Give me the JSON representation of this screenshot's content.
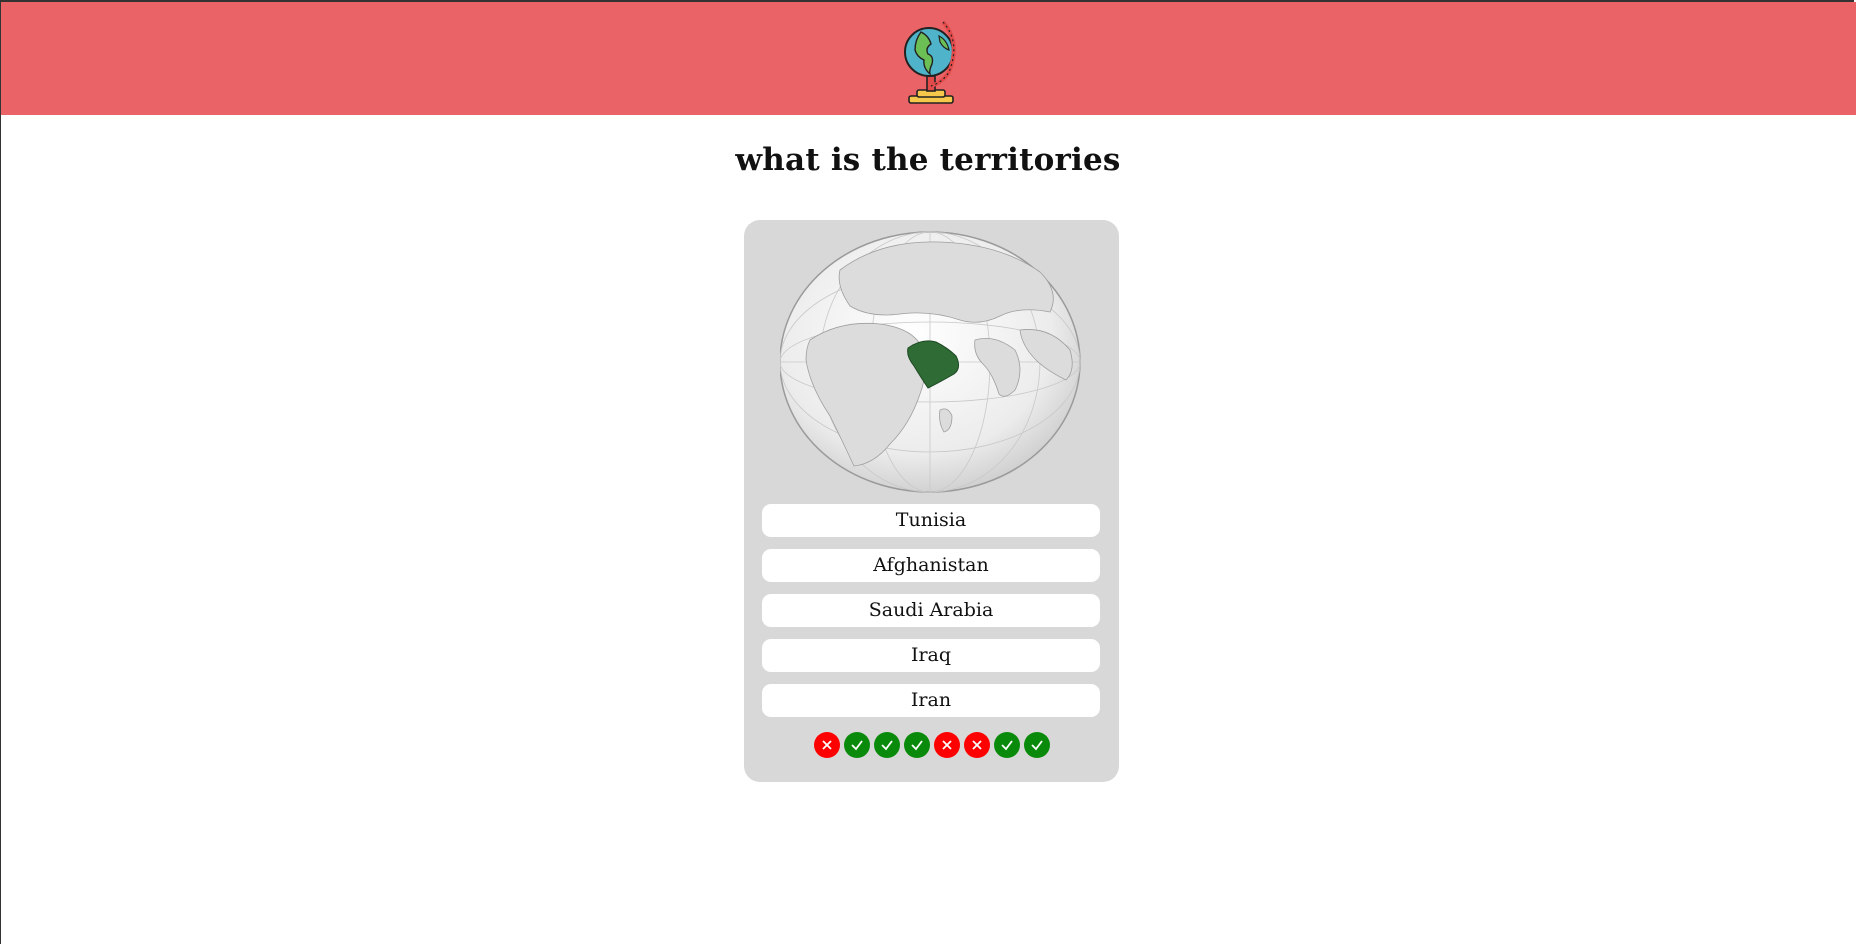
{
  "header": {
    "logo_icon": "globe-icon",
    "background_color": "#ea6366"
  },
  "question": {
    "title": "what is the territories"
  },
  "map": {
    "highlighted_region": "saudi-arabia",
    "highlight_color": "#2f6b35"
  },
  "options": [
    {
      "label": "Tunisia"
    },
    {
      "label": "Afghanistan"
    },
    {
      "label": "Saudi Arabia"
    },
    {
      "label": "Iraq"
    },
    {
      "label": "Iran"
    }
  ],
  "results": [
    {
      "status": "wrong",
      "icon": "cross-icon"
    },
    {
      "status": "right",
      "icon": "check-icon"
    },
    {
      "status": "right",
      "icon": "check-icon"
    },
    {
      "status": "right",
      "icon": "check-icon"
    },
    {
      "status": "wrong",
      "icon": "cross-icon"
    },
    {
      "status": "wrong",
      "icon": "cross-icon"
    },
    {
      "status": "right",
      "icon": "check-icon"
    },
    {
      "status": "right",
      "icon": "check-icon"
    }
  ],
  "colors": {
    "card": "#d8d8d8",
    "wrong": "#ff0000",
    "right": "#0a8a0a"
  }
}
